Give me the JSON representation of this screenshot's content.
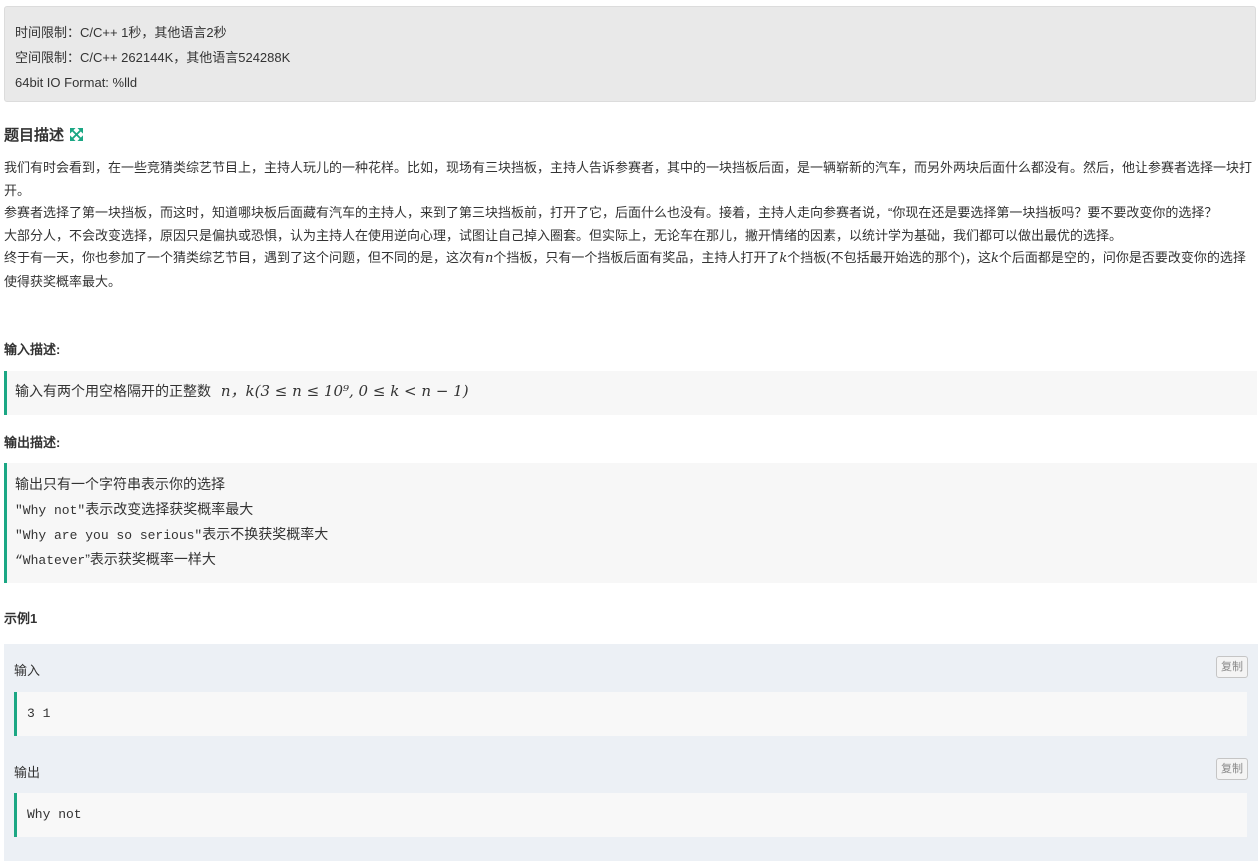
{
  "limits": {
    "time": "时间限制：C/C++ 1秒，其他语言2秒",
    "space": "空间限制：C/C++ 262144K，其他语言524288K",
    "io_format": "64bit IO Format: %lld"
  },
  "problem": {
    "title": "题目描述",
    "expand_icon": "expand-arrows-icon",
    "accent_color": "#1ba784",
    "paragraphs": {
      "p1": "我们有时会看到，在一些竞猜类综艺节目上，主持人玩儿的一种花样。比如，现场有三块挡板，主持人告诉参赛者，其中的一块挡板后面，是一辆崭新的汽车，而另外两块后面什么都没有。然后，他让参赛者选择一块打开。",
      "p2": "参赛者选择了第一块挡板，而这时，知道哪块板后面藏有汽车的主持人，来到了第三块挡板前，打开了它，后面什么也没有。接着，主持人走向参赛者说，“你现在还是要选择第一块挡板吗？要不要改变你的选择？",
      "p3": "大部分人，不会改变选择，原因只是偏执或恐惧，认为主持人在使用逆向心理，试图让自己掉入圈套。但实际上，无论车在那儿，撇开情绪的因素，以统计学为基础，我们都可以做出最优的选择。",
      "p4_a": "终于有一天，你也参加了一个猜类综艺节目，遇到了这个问题，但不同的是，这次有",
      "p4_var_n": "n",
      "p4_b": "个挡板，只有一个挡板后面有奖品，主持人打开了",
      "p4_var_k": "k",
      "p4_c": "个挡板(不包括最开始选的那个)，这",
      "p4_var_k2": "k",
      "p4_d": "个后面都是空的，问你是否要改变你的选择使得获奖概率最大。"
    }
  },
  "input_section": {
    "heading": "输入描述:",
    "text": "输入有两个用空格隔开的正整数",
    "formula": "n，k(3 ≤ n ≤ 10⁹, 0 ≤ k < n − 1)"
  },
  "output_section": {
    "heading": "输出描述:",
    "line1": "输出只有一个字符串表示你的选择",
    "line2_code": "\"Why not\"",
    "line2_text": "表示改变选择获奖概率最大",
    "line3_code": "\"Why are you so serious\"",
    "line3_text": "表示不换获奖概率大",
    "line4_code": "“Whatever",
    "line4_text": "”表示获奖概率一样大"
  },
  "example": {
    "heading": "示例1",
    "input_label": "输入",
    "input_value": "3 1",
    "output_label": "输出",
    "output_value": "Why not",
    "copy_label": "复制"
  }
}
